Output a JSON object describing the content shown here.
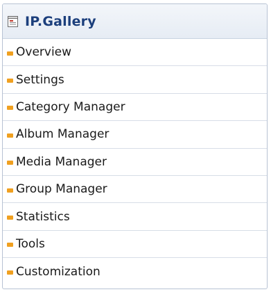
{
  "panel": {
    "title": "IP.Gallery",
    "icon": "document-icon"
  },
  "menu": {
    "items": [
      {
        "label": "Overview",
        "icon": "orange-bullet-icon"
      },
      {
        "label": "Settings",
        "icon": "orange-bullet-icon"
      },
      {
        "label": "Category Manager",
        "icon": "orange-bullet-icon"
      },
      {
        "label": "Album Manager",
        "icon": "orange-bullet-icon"
      },
      {
        "label": "Media Manager",
        "icon": "orange-bullet-icon"
      },
      {
        "label": "Group Manager",
        "icon": "orange-bullet-icon"
      },
      {
        "label": "Statistics",
        "icon": "orange-bullet-icon"
      },
      {
        "label": "Tools",
        "icon": "orange-bullet-icon"
      },
      {
        "label": "Customization",
        "icon": "orange-bullet-icon"
      }
    ]
  },
  "colors": {
    "title": "#1c3f7c",
    "bullet": "#f0a020",
    "border": "#b7c2d3"
  }
}
